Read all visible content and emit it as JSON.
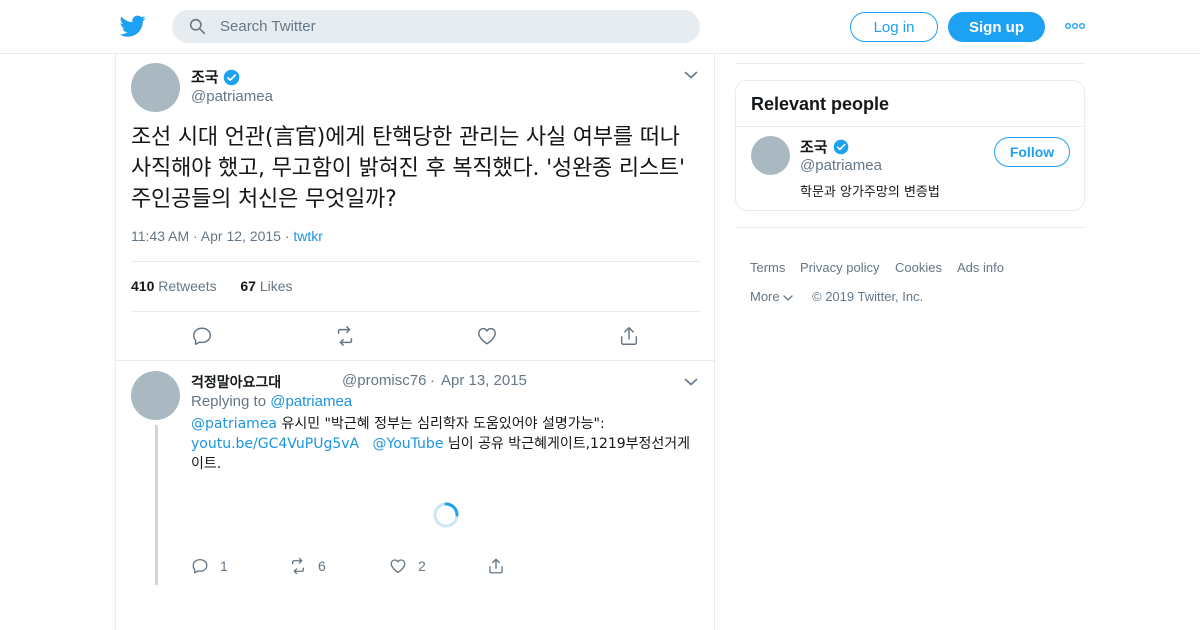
{
  "colors": {
    "accent": "#1da1f2",
    "link": "#1b95e0",
    "secondary_text": "#657786",
    "border": "#e6ecf0",
    "avatar_placeholder": "#aab8c2"
  },
  "header": {
    "logo_icon": "twitter-bird-icon",
    "search": {
      "placeholder": "Search Twitter",
      "icon": "search-icon"
    },
    "login_label": "Log in",
    "signup_label": "Sign up",
    "more_icon": "more-dots-icon"
  },
  "tweet": {
    "author_name": "조국",
    "author_handle": "@patriamea",
    "text": "조선 시대 언관(言官)에게 탄핵당한 관리는 사실 여부를 떠나 사직해야 했고, 무고함이 밝혀진 후 복직했다. '성완종 리스트' 주인공들의 처신은 무엇일까?",
    "time": "11:43 AM",
    "date": "Apr 12, 2015",
    "source": "twtkr",
    "retweets_count": "410",
    "retweets_label": "Retweets",
    "likes_count": "67",
    "likes_label": "Likes",
    "actions": [
      "reply-icon",
      "retweet-icon",
      "like-icon",
      "share-icon"
    ]
  },
  "reply": {
    "author_name": "걱정말아요그대",
    "author_handle": "@promisc76",
    "date": "Apr 13, 2015",
    "replying_prefix": "Replying to",
    "replying_to": "@patriamea",
    "mention": "@patriamea",
    "text_part1": " 유시민 \"박근혜 정부는 심리학자 도움있어야 설명가능\": ",
    "url": "youtu.be/GC4VuPUg5vA",
    "mention2": "@YouTube",
    "text_part2": " 님이 공유 박근혜게이트,1219부정선거게이트.",
    "reply_count": "1",
    "retweet_count": "6",
    "like_count": "2"
  },
  "sidebar": {
    "relevant_title": "Relevant people",
    "person": {
      "name": "조국",
      "handle": "@patriamea",
      "bio": "학문과 앙가주망의 변증법",
      "follow_label": "Follow"
    },
    "footer": {
      "terms": "Terms",
      "privacy": "Privacy policy",
      "cookies": "Cookies",
      "ads": "Ads info",
      "more": "More",
      "copyright": "© 2019 Twitter, Inc."
    }
  }
}
